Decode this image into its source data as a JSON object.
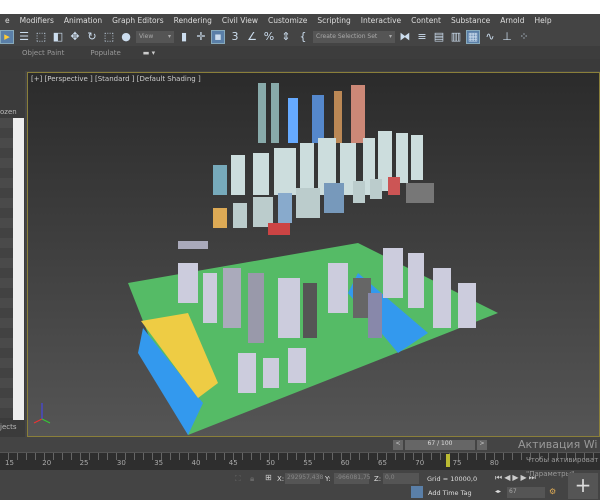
{
  "menu": [
    "e",
    "Modifiers",
    "Animation",
    "Graph Editors",
    "Rendering",
    "Civil View",
    "Customize",
    "Scripting",
    "Interactive",
    "Content",
    "Substance",
    "Arnold",
    "Help"
  ],
  "toolbar": {
    "view_dropdown": "View",
    "selection_set": "Create Selection Set"
  },
  "ribbon": {
    "object_paint": "Object Paint",
    "populate": "Populate"
  },
  "scene_explorer": {
    "header": "ozen",
    "footer": "jects"
  },
  "viewport": {
    "label": "[+] [Perspective ] [Standard ] [Default Shading ]"
  },
  "time": {
    "slider_label": "67 / 100",
    "current_frame": 67,
    "total_frames": 100,
    "ticks": [
      "15",
      "20",
      "25",
      "30",
      "35",
      "40",
      "45",
      "50",
      "55",
      "60",
      "65",
      "70",
      "75",
      "80"
    ]
  },
  "status": {
    "x_label": "X:",
    "x": "292957,438",
    "y_label": "Y:",
    "y": "-966081,75",
    "z_label": "Z:",
    "z": "0,0",
    "grid": "Grid = 10000,0",
    "add_time_tag": "Add Time Tag",
    "frame_field": "67"
  },
  "watermark": {
    "title": "Активация Wi",
    "line1": "Чтобы активироват",
    "line2": "\"Параметры\"."
  }
}
